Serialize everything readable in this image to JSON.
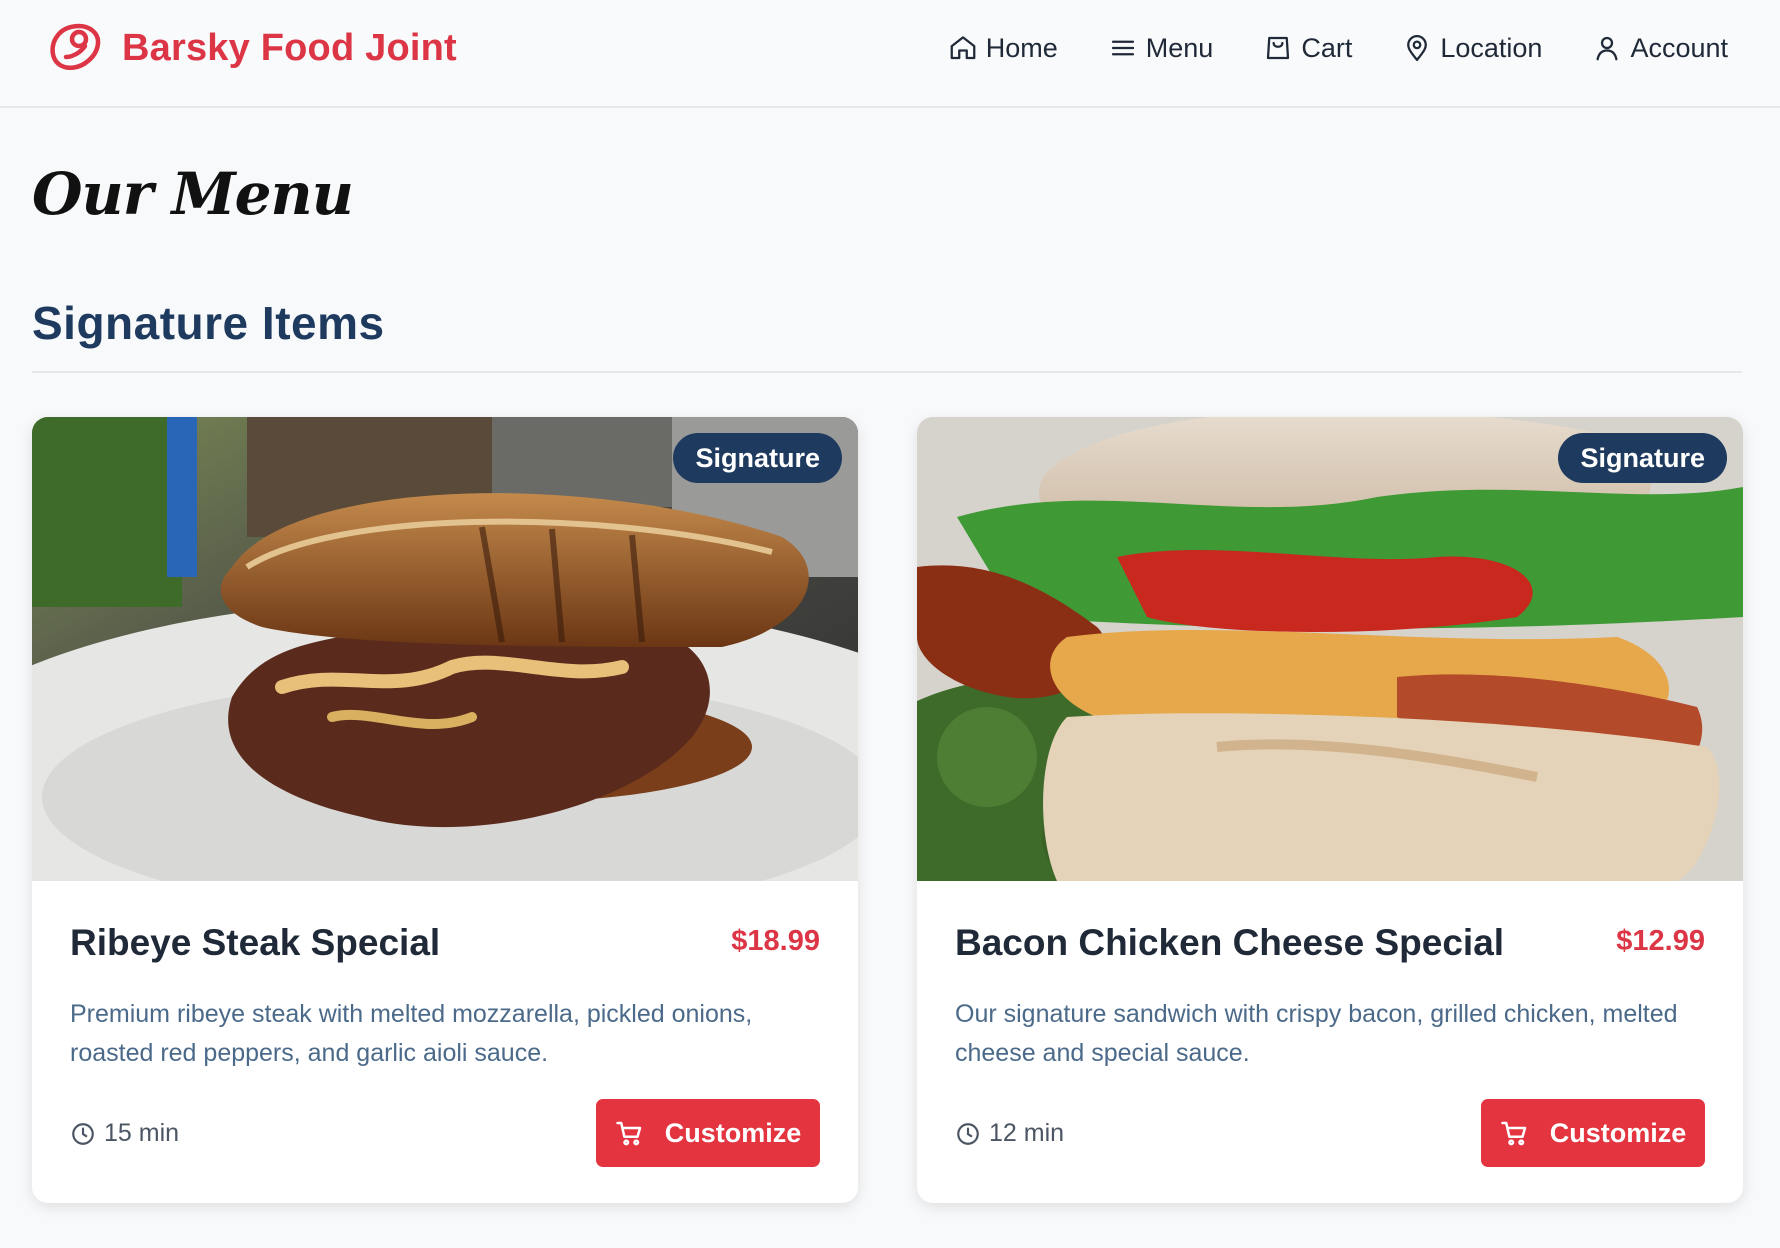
{
  "header": {
    "brand_name": "Barsky Food Joint",
    "brand_icon": "steak-icon",
    "nav": [
      {
        "label": "Home",
        "icon": "home-icon"
      },
      {
        "label": "Menu",
        "icon": "menu-icon"
      },
      {
        "label": "Cart",
        "icon": "cart-icon"
      },
      {
        "label": "Location",
        "icon": "location-pin-icon"
      },
      {
        "label": "Account",
        "icon": "user-icon"
      }
    ]
  },
  "page": {
    "script_title": "Our Menu",
    "section_title": "Signature Items"
  },
  "items": [
    {
      "badge": "Signature",
      "name": "Ribeye Steak Special",
      "price": "$18.99",
      "description": "Premium ribeye steak with melted mozzarella, pickled onions, roasted red peppers, and garlic aioli sauce.",
      "time": "15 min",
      "button_label": "Customize"
    },
    {
      "badge": "Signature",
      "name": "Bacon Chicken Cheese Special",
      "price": "$12.99",
      "description": "Our signature sandwich with crispy bacon, grilled chicken, melted cheese and special sauce.",
      "time": "12 min",
      "button_label": "Customize"
    }
  ],
  "colors": {
    "brand_red": "#dc3545",
    "navy": "#1e3a5f",
    "button_red": "#e3343f",
    "description_blue": "#4b6a8a",
    "background": "#f8f9fa"
  }
}
